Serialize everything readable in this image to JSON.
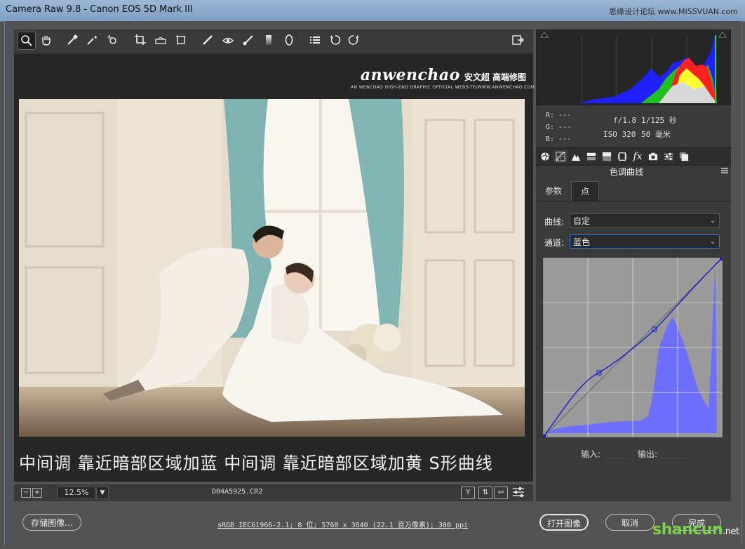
{
  "window": {
    "title": "Camera Raw 9.8 -  Canon EOS 5D Mark III",
    "watermark": "思缘设计论坛 www.MISSVUAN.com"
  },
  "toolbar": {
    "tools": [
      "zoom-icon",
      "hand-icon",
      "white-balance-icon",
      "color-sampler-icon",
      "targeted-adjust-icon",
      "crop-icon",
      "straighten-icon",
      "transform-icon",
      "spot-removal-icon",
      "red-eye-icon",
      "adjustment-brush-icon",
      "graduated-filter-icon",
      "radial-filter-icon",
      "preferences-icon",
      "rotate-ccw-icon",
      "rotate-cw-icon"
    ],
    "fullscreen_icon": "fullscreen-icon"
  },
  "preview": {
    "brand_main": "anwenchao",
    "brand_cn": "安文超 高端修图",
    "brand_sub": "AN WENCHAO HIGH-END GRAPHIC OFFICIAL WEBSITE/WWW.ANWENCHAO.COM",
    "caption": "中间调 靠近暗部区域加蓝 中间调 靠近暗部区域加黄 S形曲线"
  },
  "statusbar": {
    "zoom_out": "−",
    "zoom_in": "+",
    "zoom": "12.5%",
    "filename": "D04A5925.CR2",
    "view_y": "Y"
  },
  "histogram": {
    "rgb": {
      "r": "R:  ---",
      "g": "G:  ---",
      "b": "B:  ---"
    },
    "aperture": "f/1.8",
    "shutter": "1/125 秒",
    "iso": "ISO 320",
    "focal": "50 毫米"
  },
  "panel": {
    "tabs": [
      "basic-icon",
      "tone-curve-icon",
      "detail-icon",
      "hsl-icon",
      "split-toning-icon",
      "lens-corrections-icon",
      "effects-icon",
      "camera-calibration-icon",
      "presets-icon",
      "snapshots-icon"
    ],
    "title": "色调曲线",
    "subtabs": {
      "parametric": "参数",
      "point": "点"
    },
    "curve_label": "曲线:",
    "curve_value": "自定",
    "channel_label": "通道:",
    "channel_value": "蓝色",
    "input_label": "输入:",
    "output_label": "输出:",
    "curve_points": [
      [
        0,
        0
      ],
      [
        0.31,
        0.36
      ],
      [
        0.62,
        0.6
      ],
      [
        1,
        1
      ]
    ]
  },
  "footer": {
    "save": "存储图像...",
    "info": "sRGB IEC61966-2.1; 8 位; 5760 x 3840 (22.1 百万像素); 300 ppi",
    "open": "打开图像",
    "cancel": "取消",
    "done": "完成",
    "site_mark": "shancun",
    "site_mark_suffix": ".net"
  },
  "colors": {
    "accent": "#2e7bd6",
    "histogram_blue": "#6f6fff",
    "curve_bg": "#9a9a9a"
  }
}
